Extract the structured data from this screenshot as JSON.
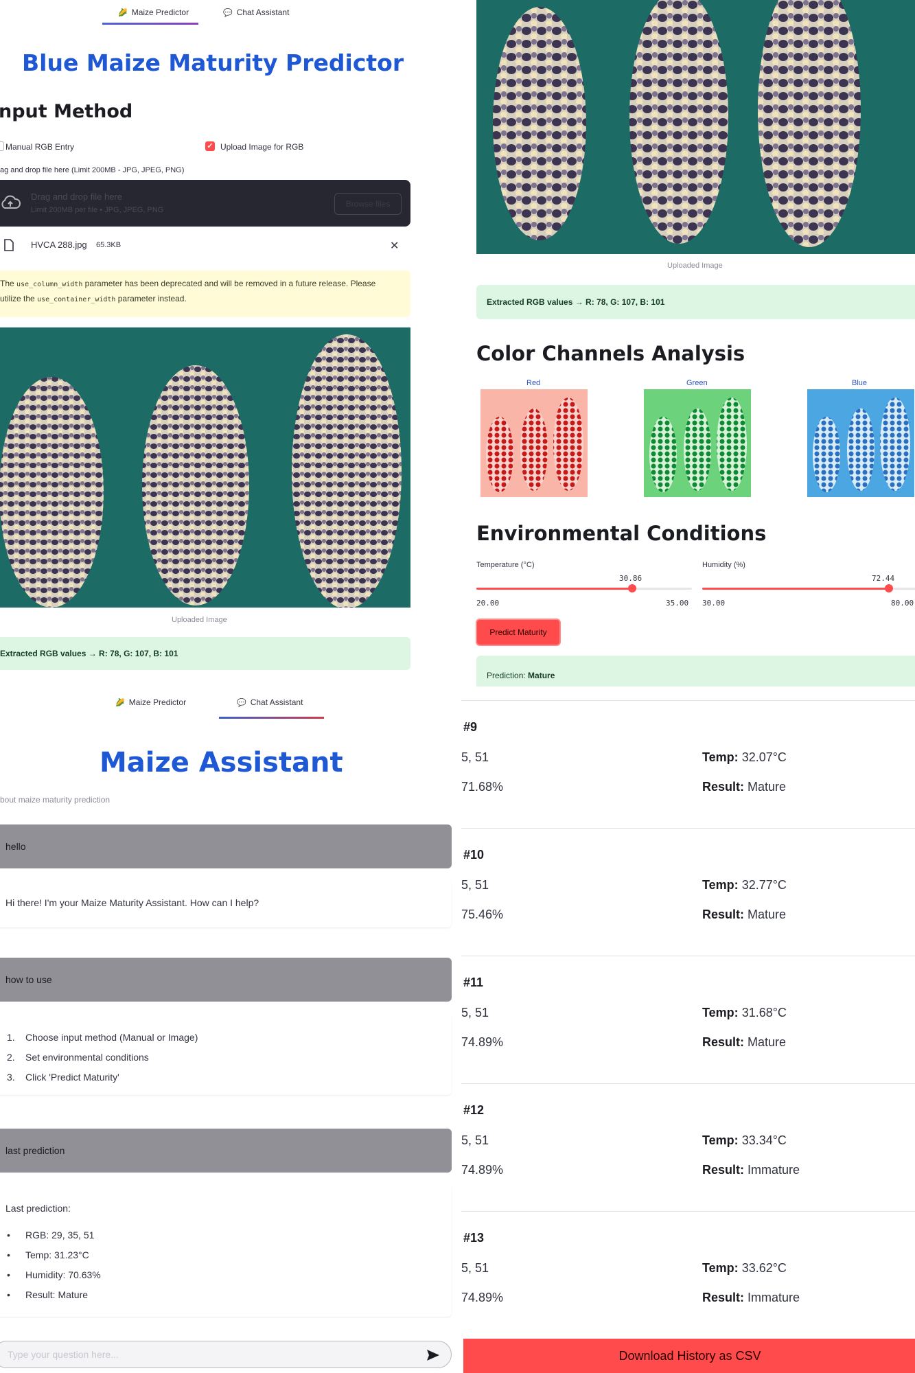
{
  "tabs": {
    "predictor": "Maize Predictor",
    "chat": "Chat Assistant",
    "predictor_icon": "🌽",
    "chat_icon": "💬"
  },
  "predictor": {
    "title": "Blue Maize Maturity Predictor",
    "input_method_heading": "nput Method",
    "manual_label": "Manual RGB Entry",
    "upload_label": "Upload Image for RGB",
    "manual_checked": false,
    "upload_checked": true,
    "dropzone_label": "ag and drop file here (Limit 200MB - JPG, JPEG, PNG)",
    "dropzone_title": "Drag and drop file here",
    "dropzone_limit": "Limit 200MB per file • JPG, JPEG, PNG",
    "browse_button": "Browse files",
    "file_name": "HVCA 288.jpg",
    "file_size": "65.3KB",
    "warning": {
      "part1": "The ",
      "code1": "use_column_width",
      "part2": " parameter has been deprecated and will be removed in a future release. Please",
      "part3": "utilize the ",
      "code2": "use_container_width",
      "part4": " parameter instead."
    },
    "image_caption": "Uploaded Image",
    "extracted": "Extracted RGB values → R: 78, G: 107, B: 101"
  },
  "analysis": {
    "image_caption": "Uploaded Image",
    "extracted": "Extracted RGB values → R: 78, G: 107, B: 101",
    "channels_heading": "Color Channels Analysis",
    "channels": [
      {
        "label": "Red",
        "color": "#d62020"
      },
      {
        "label": "Green",
        "color": "#16913a"
      },
      {
        "label": "Blue",
        "color": "#2a6fc0"
      }
    ],
    "env_heading": "Environmental Conditions",
    "temperature": {
      "label": "Temperature (°C)",
      "value": "30.86",
      "min": "20.00",
      "max": "35.00",
      "fraction": 0.724
    },
    "humidity": {
      "label": "Humidity (%)",
      "value": "72.44",
      "min": "30.00",
      "max": "80.00",
      "fraction": 0.849
    },
    "predict_button": "Predict Maturity",
    "prediction_label": "Prediction: ",
    "prediction_value": "Mature"
  },
  "chat": {
    "title": "Maize Assistant",
    "subtitle": "bout maize maturity prediction",
    "messages": {
      "user1": "hello",
      "bot1": "Hi there! I'm your Maize Maturity Assistant. How can I help?",
      "user2": "how to use",
      "bot2_steps": [
        "Choose input method (Manual or Image)",
        "Set environmental conditions",
        "Click 'Predict Maturity'"
      ],
      "user3": "last prediction",
      "bot3_intro": "Last prediction:",
      "bot3_items": [
        "RGB: 29, 35, 51",
        "Temp: 31.23°C",
        "Humidity: 70.63%",
        "Result: Mature"
      ]
    },
    "input_placeholder": "Type your question here..."
  },
  "history": {
    "records": [
      {
        "id": "#9",
        "rgb": "5, 51",
        "humidity": "71.68%",
        "temp": "32.07°C",
        "result": "Mature"
      },
      {
        "id": "#10",
        "rgb": "5, 51",
        "humidity": "75.46%",
        "temp": "32.77°C",
        "result": "Mature"
      },
      {
        "id": "#11",
        "rgb": "5, 51",
        "humidity": "74.89%",
        "temp": "31.68°C",
        "result": "Mature"
      },
      {
        "id": "#12",
        "rgb": "5, 51",
        "humidity": "74.89%",
        "temp": "33.34°C",
        "result": "Immature"
      },
      {
        "id": "#13",
        "rgb": "5, 51",
        "humidity": "74.89%",
        "temp": "33.62°C",
        "result": "Immature"
      }
    ],
    "temp_label": "Temp:",
    "result_label": "Result:",
    "download_button": "Download History as CSV"
  },
  "colors": {
    "accent": "#ff4b4b",
    "title_blue": "#1f58d4",
    "success_bg": "#dcf6e3",
    "warning_bg": "#fffbd6",
    "chat_user_bg": "#909096"
  }
}
